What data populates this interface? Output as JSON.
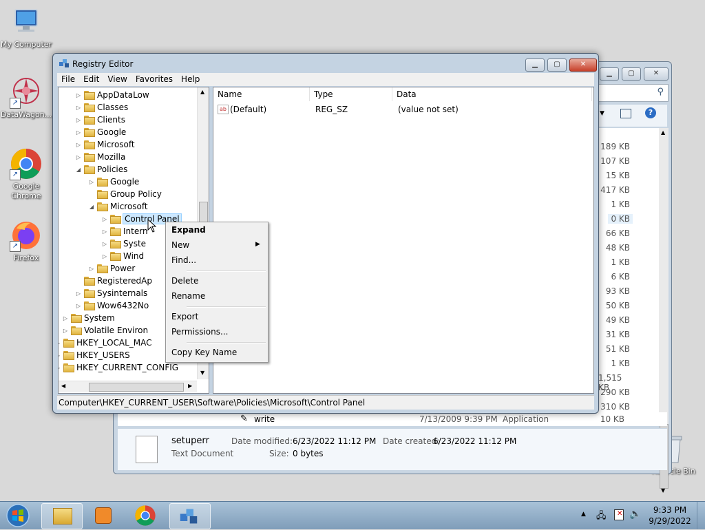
{
  "desktop": {
    "icons": [
      {
        "label": "My Computer"
      },
      {
        "label": "DataWagon..."
      },
      {
        "label": "Google Chrome"
      },
      {
        "label": "Firefox"
      },
      {
        "label": "Recycle Bin"
      }
    ]
  },
  "explorer_bg": {
    "sizes": [
      "189 KB",
      "107 KB",
      "15 KB",
      "417 KB",
      "1 KB",
      "0 KB",
      "66 KB",
      "48 KB",
      "1 KB",
      "6 KB",
      "93 KB",
      "50 KB",
      "49 KB",
      "31 KB",
      "51 KB",
      "1 KB",
      "1,515 KB",
      "290 KB",
      "310 KB"
    ],
    "last_row": {
      "name": "write",
      "date": "7/13/2009 9:39 PM",
      "type": "Application",
      "size": "10 KB"
    },
    "details": {
      "name": "setuperr",
      "type": "Text Document",
      "date_modified_label": "Date modified:",
      "date_modified": "6/23/2022 11:12 PM",
      "date_created_label": "Date created:",
      "date_created": "6/23/2022 11:12 PM",
      "size_label": "Size:",
      "size": "0 bytes"
    }
  },
  "regedit": {
    "title": "Registry Editor",
    "menu": [
      "File",
      "Edit",
      "View",
      "Favorites",
      "Help"
    ],
    "tree": [
      "AppDataLow",
      "Classes",
      "Clients",
      "Google",
      "Microsoft",
      "Mozilla",
      "Policies",
      "Google",
      "Group Policy",
      "Microsoft",
      "Control Panel",
      "Intern",
      "Syste",
      "Wind",
      "Power",
      "RegisteredAp",
      "Sysinternals",
      "Wow6432No",
      "System",
      "Volatile Environ",
      "HKEY_LOCAL_MAC",
      "HKEY_USERS",
      "HKEY_CURRENT_CONFIG"
    ],
    "columns": {
      "name": "Name",
      "type": "Type",
      "data": "Data"
    },
    "values": [
      {
        "name": "(Default)",
        "type": "REG_SZ",
        "data": "(value not set)",
        "icon": "ab"
      }
    ],
    "status_path": "Computer\\HKEY_CURRENT_USER\\Software\\Policies\\Microsoft\\Control Panel"
  },
  "context_menu": {
    "expand": "Expand",
    "new": "New",
    "find": "Find...",
    "delete": "Delete",
    "rename": "Rename",
    "export": "Export",
    "permissions": "Permissions...",
    "copy_key": "Copy Key Name"
  },
  "taskbar": {
    "time": "9:33 PM",
    "date": "9/29/2022"
  }
}
